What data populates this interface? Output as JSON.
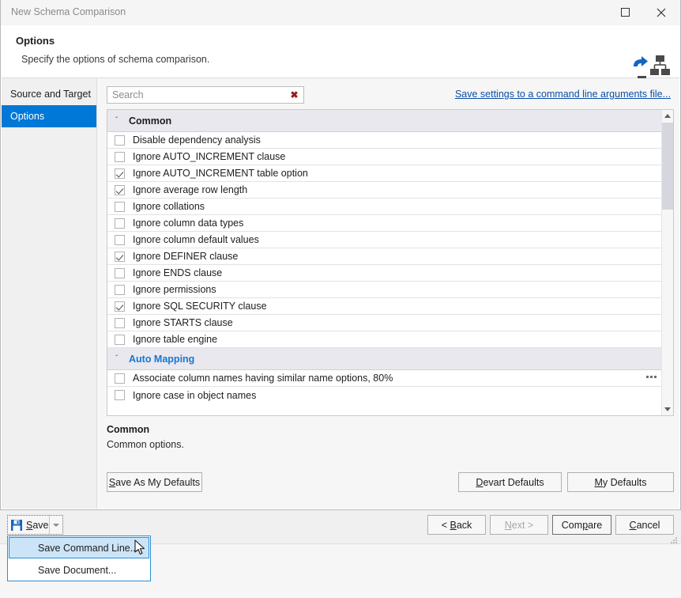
{
  "window": {
    "title": "New Schema Comparison",
    "maximize_label": "Maximize",
    "close_label": "Close"
  },
  "header": {
    "title": "Options",
    "subtitle": "Specify the options of schema comparison.",
    "icon": "schema-compare-icon"
  },
  "sidebar": {
    "items": [
      {
        "label": "Source and Target",
        "selected": false
      },
      {
        "label": "Options",
        "selected": true
      }
    ]
  },
  "search": {
    "value": "",
    "placeholder": "Search",
    "clear_glyph": "✖"
  },
  "links": {
    "save_command_line_args": "Save settings to a command line arguments file..."
  },
  "options_list": {
    "groups": [
      {
        "name": "Common",
        "accent": false,
        "expanded": true,
        "chevron": "ˇ",
        "rows": [
          {
            "label": "Disable dependency analysis",
            "checked": false,
            "ellipsis": false
          },
          {
            "label": "Ignore AUTO_INCREMENT clause",
            "checked": false,
            "ellipsis": false
          },
          {
            "label": "Ignore AUTO_INCREMENT table option",
            "checked": true,
            "ellipsis": false
          },
          {
            "label": "Ignore average row length",
            "checked": true,
            "ellipsis": false
          },
          {
            "label": "Ignore collations",
            "checked": false,
            "ellipsis": false
          },
          {
            "label": "Ignore column data types",
            "checked": false,
            "ellipsis": false
          },
          {
            "label": "Ignore column default values",
            "checked": false,
            "ellipsis": false
          },
          {
            "label": "Ignore DEFINER clause",
            "checked": true,
            "ellipsis": false
          },
          {
            "label": "Ignore ENDS clause",
            "checked": false,
            "ellipsis": false
          },
          {
            "label": "Ignore permissions",
            "checked": false,
            "ellipsis": false
          },
          {
            "label": "Ignore SQL SECURITY clause",
            "checked": true,
            "ellipsis": false
          },
          {
            "label": "Ignore STARTS clause",
            "checked": false,
            "ellipsis": false
          },
          {
            "label": "Ignore table engine",
            "checked": false,
            "ellipsis": false
          }
        ]
      },
      {
        "name": "Auto Mapping",
        "accent": true,
        "expanded": true,
        "chevron": "ˇ",
        "rows": [
          {
            "label": "Associate column names having similar name options, 80%",
            "checked": false,
            "ellipsis": true
          },
          {
            "label": "Ignore case in object names",
            "checked": false,
            "ellipsis": false
          }
        ]
      }
    ]
  },
  "description": {
    "title": "Common",
    "text": "Common options."
  },
  "defaults_buttons": [
    {
      "label": "Save As My Defaults",
      "mnemonic": "S"
    },
    {
      "label": "Devart Defaults",
      "mnemonic": "D"
    },
    {
      "label": "My Defaults",
      "mnemonic": "M"
    }
  ],
  "bottom_bar": {
    "save_button": {
      "label": "Save",
      "mnemonic": "S",
      "icon": "floppy-disk-icon"
    },
    "nav_buttons": [
      {
        "label": "< Back",
        "mnemonic": "B",
        "state": "enabled"
      },
      {
        "label": "Next >",
        "mnemonic": "N",
        "state": "disabled"
      },
      {
        "label": "Compare",
        "mnemonic": "p",
        "state": "default"
      },
      {
        "label": "Cancel",
        "mnemonic": "C",
        "state": "enabled"
      }
    ]
  },
  "dropdown_menu": {
    "items": [
      {
        "label": "Save Command Line...",
        "highlighted": true
      },
      {
        "label": "Save Document...",
        "highlighted": false
      }
    ]
  },
  "colors": {
    "accent_blue": "#0078d7",
    "link_blue": "#0b4fa8",
    "group_accent": "#1976d2",
    "menu_highlight": "#cce4f7",
    "clear_red": "#9b1c1c"
  }
}
